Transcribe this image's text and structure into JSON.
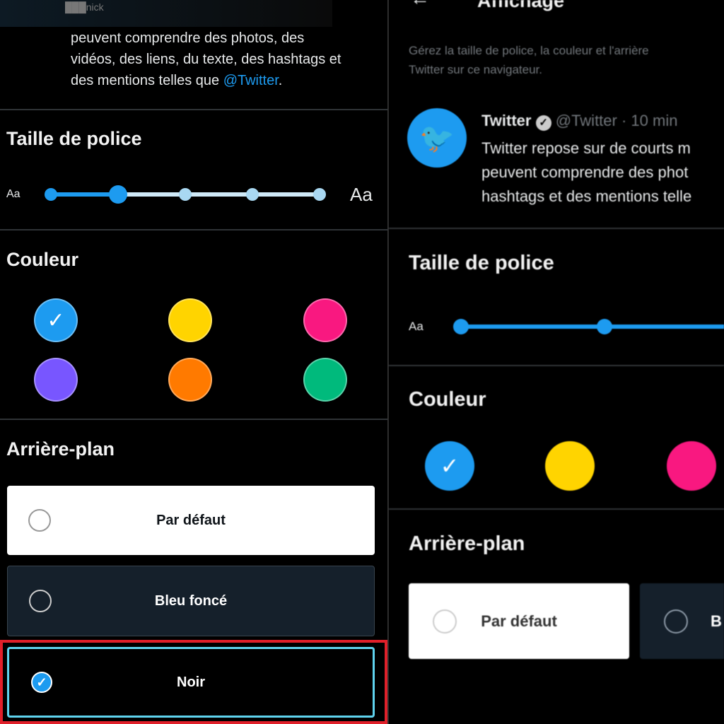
{
  "left": {
    "username": "███nick",
    "tweet_lines": [
      "peuvent comprendre des photos, des",
      "vidéos, des liens, du texte, des hashtags et",
      "des mentions telles que "
    ],
    "mention": "@Twitter",
    "period": ".",
    "font_size_title": "Taille de police",
    "font_small": "Aa",
    "font_large": "Aa",
    "font_size_level": 2,
    "font_size_steps": 5,
    "color_title": "Couleur",
    "colors": [
      "#1d9bf0",
      "#ffd400",
      "#f91880",
      "#7856ff",
      "#ff7a00",
      "#00ba7c"
    ],
    "selected_color": 0,
    "background_title": "Arrière-plan",
    "backgrounds": [
      {
        "label": "Par défaut",
        "checked": false
      },
      {
        "label": "Bleu foncé",
        "checked": false
      },
      {
        "label": "Noir",
        "checked": true
      }
    ],
    "highlight_color": "#e0202a"
  },
  "right": {
    "title": "Affichage",
    "description": [
      "Gérez la taille de police, la couleur et l'arrière",
      "Twitter sur ce navigateur."
    ],
    "tweet_name": "Twitter",
    "tweet_handle": "@Twitter · 10 min",
    "tweet_lines": [
      "Twitter repose sur de courts m",
      "peuvent comprendre des phot",
      "hashtags et des mentions telle"
    ],
    "font_size_title": "Taille de police",
    "font_small": "Aa",
    "color_title": "Couleur",
    "colors": [
      "#1d9bf0",
      "#ffd400",
      "#f91880"
    ],
    "background_title": "Arrière-plan",
    "backgrounds": [
      "Par défaut",
      "B"
    ]
  }
}
